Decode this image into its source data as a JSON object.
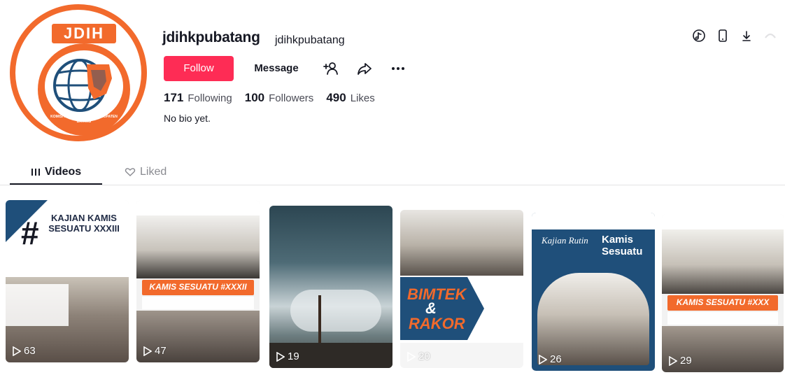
{
  "profile": {
    "username": "jdihkpubatang",
    "nickname": "jdihkpubatang",
    "bio": "No bio yet.",
    "avatar_text": "JDIH",
    "avatar_caption": "KOMISI PEMILIHAN UMUM KABUPATEN BATANG"
  },
  "actions": {
    "follow_label": "Follow",
    "message_label": "Message",
    "icons": [
      "add-friend-icon",
      "share-icon",
      "more-icon"
    ]
  },
  "stats": [
    {
      "value": "171",
      "label": "Following"
    },
    {
      "value": "100",
      "label": "Followers"
    },
    {
      "value": "490",
      "label": "Likes"
    }
  ],
  "top_icons": [
    "tiktok-icon",
    "phone-icon",
    "download-icon",
    "blurred-icon"
  ],
  "tabs": [
    {
      "label": "Videos",
      "icon": "grid-icon",
      "active": true
    },
    {
      "label": "Liked",
      "icon": "heart-icon",
      "active": false
    }
  ],
  "videos": [
    {
      "views": "63",
      "title": "KAJIAN KAMIS SESUATU XXXIII",
      "mark": "#"
    },
    {
      "views": "47",
      "title": "KAMIS SESUATU #XXXII"
    },
    {
      "views": "19",
      "title": ""
    },
    {
      "views": "20",
      "title_line1": "BIMTEK",
      "title_line2": "&",
      "title_line3": "RAKOR"
    },
    {
      "views": "26",
      "title_line1": "Kajian Rutin",
      "title_line2": "Kamis Sesuatu"
    },
    {
      "views": "29",
      "title": "KAMIS SESUATU #XXX"
    }
  ],
  "colors": {
    "accent": "#fe2c55",
    "brand_orange": "#f26a2c",
    "navy": "#1f4f7a"
  }
}
